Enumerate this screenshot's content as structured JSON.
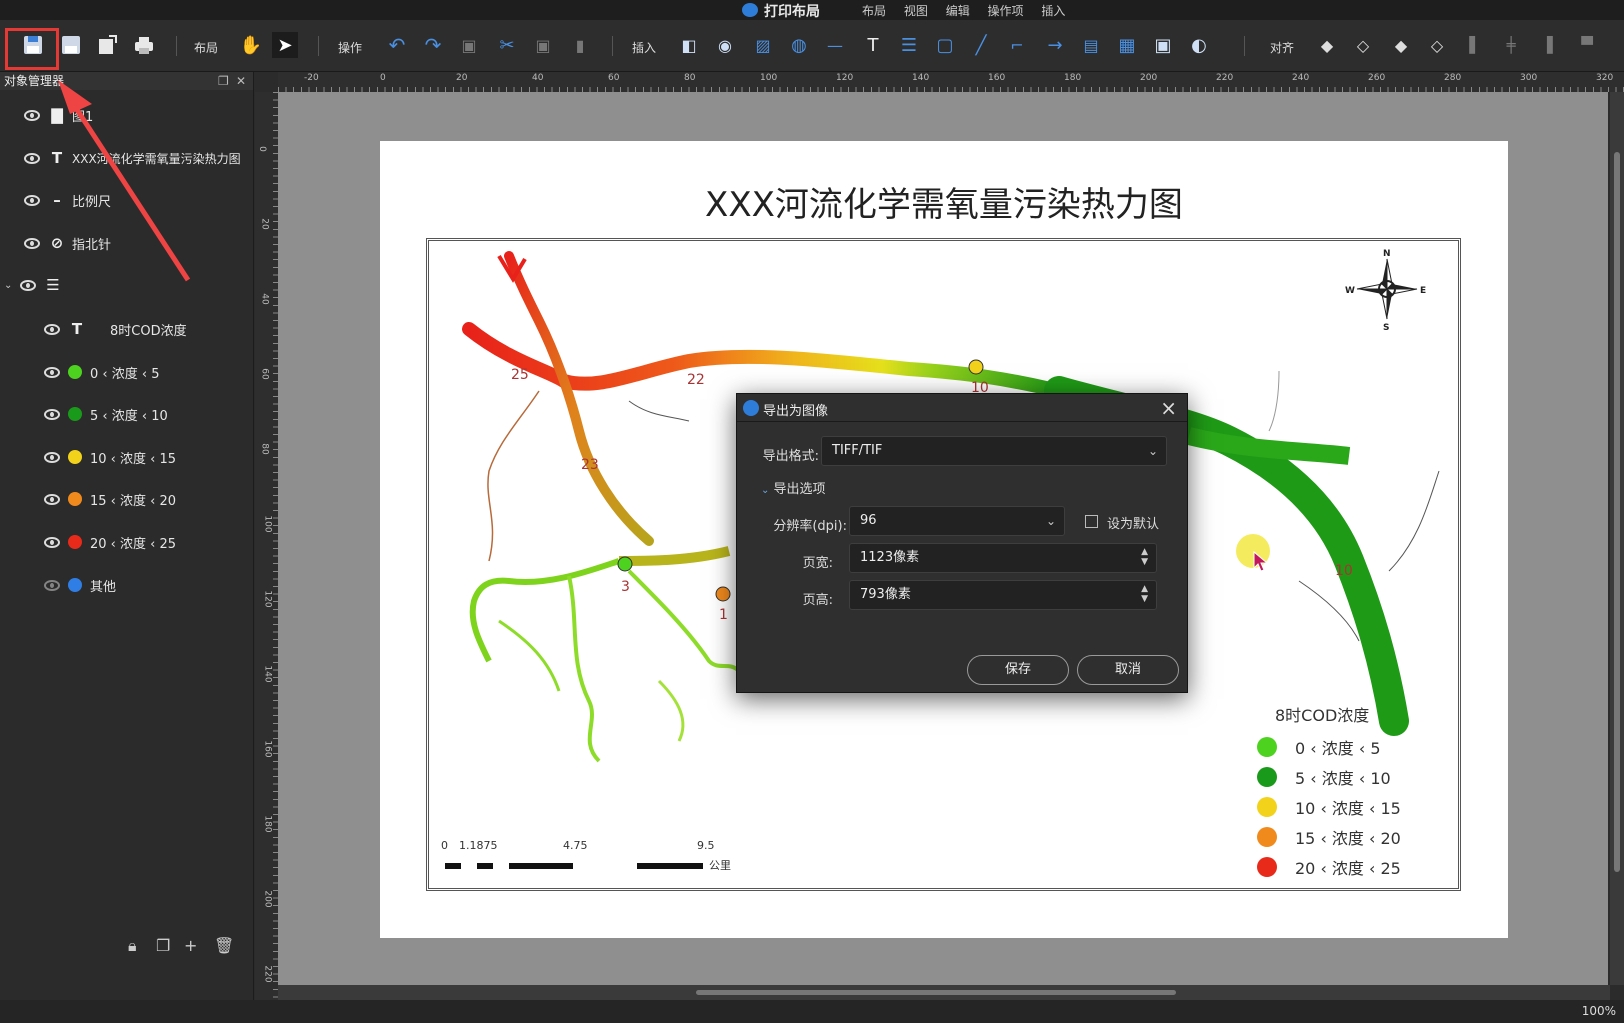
{
  "app": {
    "title": "打印布局",
    "menus": [
      "布局",
      "视图",
      "编辑",
      "操作项",
      "插入"
    ]
  },
  "toolbar": {
    "layout_label": "布局",
    "operate_label": "操作",
    "insert_label": "插入",
    "align_label": "对齐"
  },
  "sidebar": {
    "title": "对象管理器",
    "items": [
      {
        "label": "图1",
        "icon": "folder-icon"
      },
      {
        "label": "XXX河流化学需氧量污染热力图",
        "icon": "text-icon"
      },
      {
        "label": "比例尺",
        "icon": "scalebar-icon"
      },
      {
        "label": "指北针",
        "icon": "compass-icon"
      },
      {
        "label": "",
        "icon": "legend-icon"
      },
      {
        "label": "8时COD浓度",
        "icon": "text-icon"
      },
      {
        "label": "0 ‹ 浓度 ‹ 5",
        "color": "#4cd21f"
      },
      {
        "label": "5 ‹ 浓度 ‹ 10",
        "color": "#1a9a1a"
      },
      {
        "label": "10 ‹ 浓度 ‹ 15",
        "color": "#f2d21b"
      },
      {
        "label": "15 ‹ 浓度 ‹ 20",
        "color": "#f08a1c"
      },
      {
        "label": "20 ‹ 浓度 ‹ 25",
        "color": "#e82a1a"
      },
      {
        "label": "其他",
        "color": "#2f7ee6"
      }
    ]
  },
  "ruler": {
    "top": [
      "-20",
      "0",
      "20",
      "40",
      "60",
      "80",
      "100",
      "120",
      "140",
      "160",
      "180",
      "200",
      "220",
      "240",
      "260",
      "280",
      "300",
      "320"
    ],
    "left": [
      "0",
      "20",
      "40",
      "60",
      "80",
      "100",
      "120",
      "140",
      "160",
      "180",
      "200",
      "220"
    ]
  },
  "map": {
    "title": "XXX河流化学需氧量污染热力图",
    "site_labels": [
      "25",
      "22",
      "23",
      "3",
      "1",
      "10",
      "10"
    ],
    "compass_letters": {
      "n": "N",
      "s": "S",
      "e": "E",
      "w": "W"
    },
    "legend_title": "8时COD浓度",
    "legend": [
      {
        "label": "0 ‹ 浓度 ‹ 5",
        "color": "#4cd21f"
      },
      {
        "label": "5 ‹ 浓度 ‹ 10",
        "color": "#1a9a1a"
      },
      {
        "label": "10 ‹ 浓度 ‹ 15",
        "color": "#f2d21b"
      },
      {
        "label": "15 ‹ 浓度 ‹ 20",
        "color": "#f08a1c"
      },
      {
        "label": "20 ‹ 浓度 ‹ 25",
        "color": "#e82a1a"
      }
    ],
    "scalebar": {
      "ticks": [
        "0",
        "1.1875",
        "4.75",
        "9.5"
      ],
      "unit": "公里"
    }
  },
  "dialog": {
    "title": "导出为图像",
    "format_label": "导出格式:",
    "format_value": "TIFF/TIF",
    "options_label": "导出选项",
    "dpi_label": "分辨率(dpi):",
    "dpi_value": "96",
    "default_label": "设为默认",
    "width_label": "页宽:",
    "width_value": "1123像素",
    "height_label": "页高:",
    "height_value": "793像素",
    "save_label": "保存",
    "cancel_label": "取消"
  },
  "status": {
    "zoom": "100%"
  }
}
